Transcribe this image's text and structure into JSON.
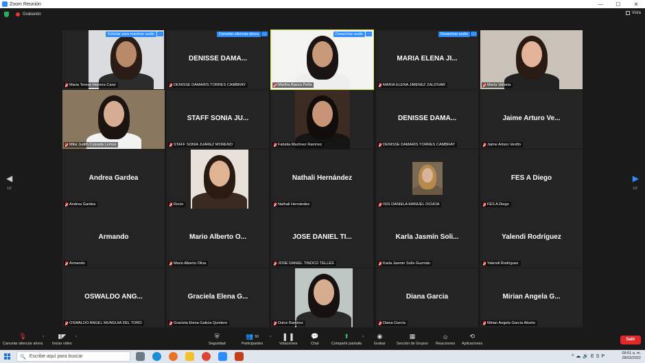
{
  "window": {
    "title": "Zoom Reunión"
  },
  "status": {
    "recording": "Grabando",
    "view": "Vista"
  },
  "pager": {
    "left": "1/2",
    "right": "1/2"
  },
  "tiles": [
    {
      "big": "",
      "label": "Maria Teresa Herrera Cano",
      "audio_btn": "Solicitar para reactivar audio",
      "has_video": true
    },
    {
      "big": "DENISSE  DAMA...",
      "label": "DENISSE DAMARIS TORRES CAMBRAY",
      "audio_btn": "Cancelar silenciar ahora",
      "has_video": false
    },
    {
      "big": "",
      "label": "Martha Baeza Peña",
      "audio_btn": "Desactivar audio",
      "has_video": true,
      "active": true
    },
    {
      "big": "MARIA  ELENA  JI...",
      "label": "MARIA ELENA JIMENEZ ZALDIVAR",
      "audio_btn": "Desactivar audio",
      "has_video": false
    },
    {
      "big": "",
      "label": "María Vallarta",
      "audio_btn": "",
      "has_video": true
    },
    {
      "big": "",
      "label": "Mitsi Judith Calzada Lemus",
      "audio_btn": "",
      "has_video": true
    },
    {
      "big": "STAFF  SONIA  JU...",
      "label": "STAFF SONIA JUÁREZ MORENO",
      "audio_btn": "",
      "has_video": false
    },
    {
      "big": "",
      "label": "Fabiola Martínez Ramírez",
      "audio_btn": "",
      "has_video": true
    },
    {
      "big": "DENISSE  DAMA...",
      "label": "DENISSE DAMARIS TORRES CAMBRAY",
      "audio_btn": "",
      "has_video": false
    },
    {
      "big": "Jaime Arturo Ve...",
      "label": "Jaime Arturo Verdín",
      "audio_btn": "",
      "has_video": false
    },
    {
      "big": "Andrea Gardea",
      "label": "Andrea Gardea",
      "audio_btn": "",
      "has_video": false
    },
    {
      "big": "",
      "label": "Rocio",
      "audio_btn": "",
      "has_video": true
    },
    {
      "big": "Nathali Hernández",
      "label": "Nathali Hernández",
      "audio_btn": "",
      "has_video": false
    },
    {
      "big": "",
      "label": "ISIS DANIELA MANUEL OCHOA",
      "audio_btn": "",
      "has_video": true
    },
    {
      "big": "FES A Diego",
      "label": "FES A Diego",
      "audio_btn": "",
      "has_video": false
    },
    {
      "big": "Armando",
      "label": "Armando",
      "audio_btn": "",
      "has_video": false
    },
    {
      "big": "Mario Alberto O...",
      "label": "Mario Alberto Oliva",
      "audio_btn": "",
      "has_video": false
    },
    {
      "big": "JOSE DANIEL TI...",
      "label": "JOSE DANIEL TINOCO TELLES",
      "audio_btn": "",
      "has_video": false
    },
    {
      "big": "Karla Jasmín Soli...",
      "label": "Karla Jasmin Solís Guzmán",
      "audio_btn": "",
      "has_video": false
    },
    {
      "big": "Yalendi Rodríguez",
      "label": "Yalendi Rodríguez",
      "audio_btn": "",
      "has_video": false
    },
    {
      "big": "OSWALDO  ANG...",
      "label": "OSWALDO ANGEL MUNGUIA DEL TORO",
      "audio_btn": "",
      "has_video": false
    },
    {
      "big": "Graciela Elena G...",
      "label": "Graciela Elena Galicia Quintero",
      "audio_btn": "",
      "has_video": false
    },
    {
      "big": "",
      "label": "Dulce Ramirez",
      "audio_btn": "",
      "has_video": true
    },
    {
      "big": "Diana Garcia",
      "label": "Diana García",
      "audio_btn": "",
      "has_video": false
    },
    {
      "big": "Mirian Angela G...",
      "label": "Mirian Angela García Aburto",
      "audio_btn": "",
      "has_video": false
    }
  ],
  "toolbar": {
    "mute": "Cancelar silenciar ahora",
    "video": "Iniciar video",
    "security": "Seguridad",
    "participants": "Participantes",
    "participants_count": "50",
    "polls": "Votaciones",
    "chat": "Chat",
    "share": "Compartir pantalla",
    "record": "Grabar",
    "rooms": "Sección de Grupos",
    "reactions": "Reacciones",
    "apps": "Aplicaciones",
    "leave": "Salir"
  },
  "taskbar": {
    "search_placeholder": "Escribe aquí para buscar",
    "time": "09:51 a. m.",
    "date": "28/03/2022"
  },
  "colors": {
    "accent": "#2d8cff",
    "active_speaker": "#d8e24a",
    "leave": "#e02828",
    "share": "#34c759"
  }
}
